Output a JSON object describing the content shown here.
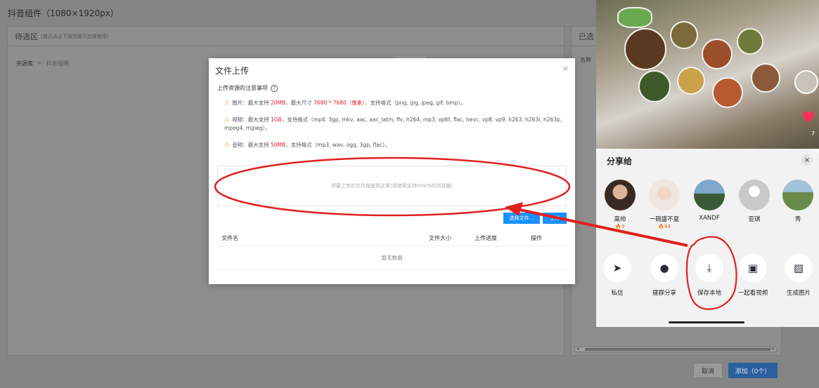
{
  "page": {
    "title": "抖音组件（1080×1920px）",
    "left_panel": {
      "title": "待选区",
      "hint": "(提示点击下面资源可选择使用)"
    },
    "breadcrumb": {
      "root": "资源库",
      "separator": ">",
      "current": "抖音视频"
    },
    "right_panel": {
      "title": "已选",
      "column": "名称"
    },
    "scroll_left": "◂",
    "scroll_right": "▸",
    "cancel_label": "取消",
    "add_label": "添加（0个）"
  },
  "modal": {
    "title": "文件上传",
    "close_glyph": "×",
    "notes_title": "上传资源的注意事项",
    "help_glyph": "?",
    "warn_glyph": "⚠",
    "image_note": {
      "pre": "图片：最大支持 ",
      "size": "20MB",
      "mid": "，最大尺寸 ",
      "dims": "7680 * 7680（像素）",
      "post": "，支持格式（png, jpg, jpeg, gif, bmp）。"
    },
    "video_note": {
      "pre": "视频：最大支持 ",
      "size": "1GB",
      "post": "，支持格式（mp4, 3gp, mkv, aac, aac_latm, flv, h264, mp3, vp6f, flac, hevc, vp8, vp9, h263, h263i, h263p, mpeg4, mjpeg）。"
    },
    "audio_note": {
      "pre": "音频：最大支持 ",
      "size": "50MB",
      "post": "，支持格式（mp3, wav, ogg, 3gp, flac）。"
    },
    "dropzone_text": "把要上传的文件拖放到这里(请使用支持html5的浏览器)",
    "select_button": "选择文件...",
    "upload_button": "上传",
    "table": {
      "columns": [
        "文件名",
        "文件大小",
        "上传进度",
        "操作"
      ],
      "empty_text": "暂无数据"
    }
  },
  "phone": {
    "like_count": "7",
    "share_title": "分享给",
    "close_glyph": "×",
    "contacts": [
      {
        "name": "高帅",
        "flame": "🔥3"
      },
      {
        "name": "一碗盛不夏",
        "flame": "🔥93"
      },
      {
        "name": "XANDF",
        "flame": ""
      },
      {
        "name": "亚琪",
        "flame": ""
      },
      {
        "name": "秀",
        "flame": ""
      }
    ],
    "actions": [
      {
        "label": "私信",
        "glyph": "➤"
      },
      {
        "label": "建群分享",
        "glyph": "●"
      },
      {
        "label": "保存本地",
        "glyph": "⤓"
      },
      {
        "label": "一起看视频",
        "glyph": "▣"
      },
      {
        "label": "生成图片",
        "glyph": "▨"
      }
    ]
  },
  "colors": {
    "accent": "#1890ff",
    "danger": "#d9232e",
    "warning": "#e6a23c",
    "annotation": "#e02020"
  }
}
